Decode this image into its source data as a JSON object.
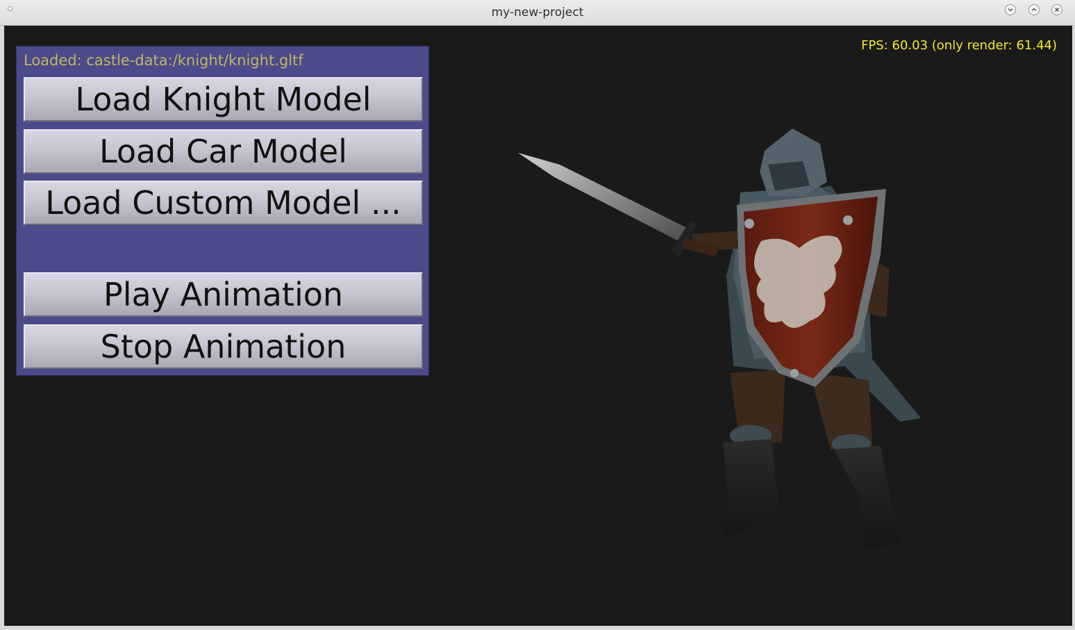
{
  "window": {
    "title": "my-new-project"
  },
  "hud": {
    "fps_text": "FPS: 60.03 (only render: 61.44)"
  },
  "panel": {
    "status": "Loaded: castle-data:/knight/knight.gltf",
    "buttons": {
      "load_knight": "Load Knight Model",
      "load_car": "Load Car Model",
      "load_custom": "Load Custom Model ...",
      "play_animation": "Play Animation",
      "stop_animation": "Stop Animation"
    }
  },
  "colors": {
    "viewport_bg": "#1a1a1a",
    "panel_bg": "#4b4a8a",
    "status_text": "#c3b760",
    "fps_text": "#f3ea2a"
  },
  "icons": {
    "minimize": "chevron-down-icon",
    "maximize": "chevron-up-icon",
    "close": "close-icon"
  }
}
